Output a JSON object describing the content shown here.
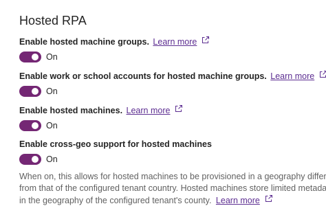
{
  "section": {
    "title": "Hosted RPA"
  },
  "settings": [
    {
      "label": "Enable hosted machine groups.",
      "link": "Learn more",
      "state": "On",
      "enabled": true
    },
    {
      "label": "Enable work or school accounts for hosted machine groups.",
      "link": "Learn more",
      "state": "On",
      "enabled": true
    },
    {
      "label": "Enable hosted machines.",
      "link": "Learn more",
      "state": "On",
      "enabled": true
    },
    {
      "label": "Enable cross-geo support for hosted machines",
      "state": "On",
      "enabled": true
    }
  ],
  "description": {
    "line1": "When on, this allows for hosted machines to be provisioned in a geography different",
    "line2": "from that of the configured tenant country. Hosted machines store limited metadata",
    "line3": "in the geography of the configured tenant's county.",
    "link": "Learn more"
  },
  "icons": {
    "external_link": "open-in-new-window-icon"
  },
  "colors": {
    "toggle_on": "#742774",
    "link": "#5c2d91",
    "text": "#242424",
    "muted_text": "#616161"
  }
}
